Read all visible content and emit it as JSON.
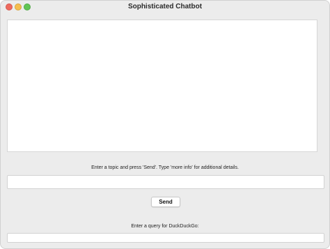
{
  "window": {
    "title": "Sophisticated Chatbot"
  },
  "chat": {
    "display_text": "",
    "instruction": "Enter a topic and press 'Send'. Type 'more info' for additional details.",
    "input_value": "",
    "send_label": "Send"
  },
  "duckduckgo": {
    "label": "Enter a query for DuckDuckGo:",
    "input_value": ""
  },
  "colors": {
    "close": "#ee6a5e",
    "minimize": "#f5be4f",
    "zoom": "#62c554",
    "window_bg": "#ececec",
    "field_bg": "#ffffff"
  },
  "icons": [
    "close-icon",
    "minimize-icon",
    "zoom-icon"
  ]
}
